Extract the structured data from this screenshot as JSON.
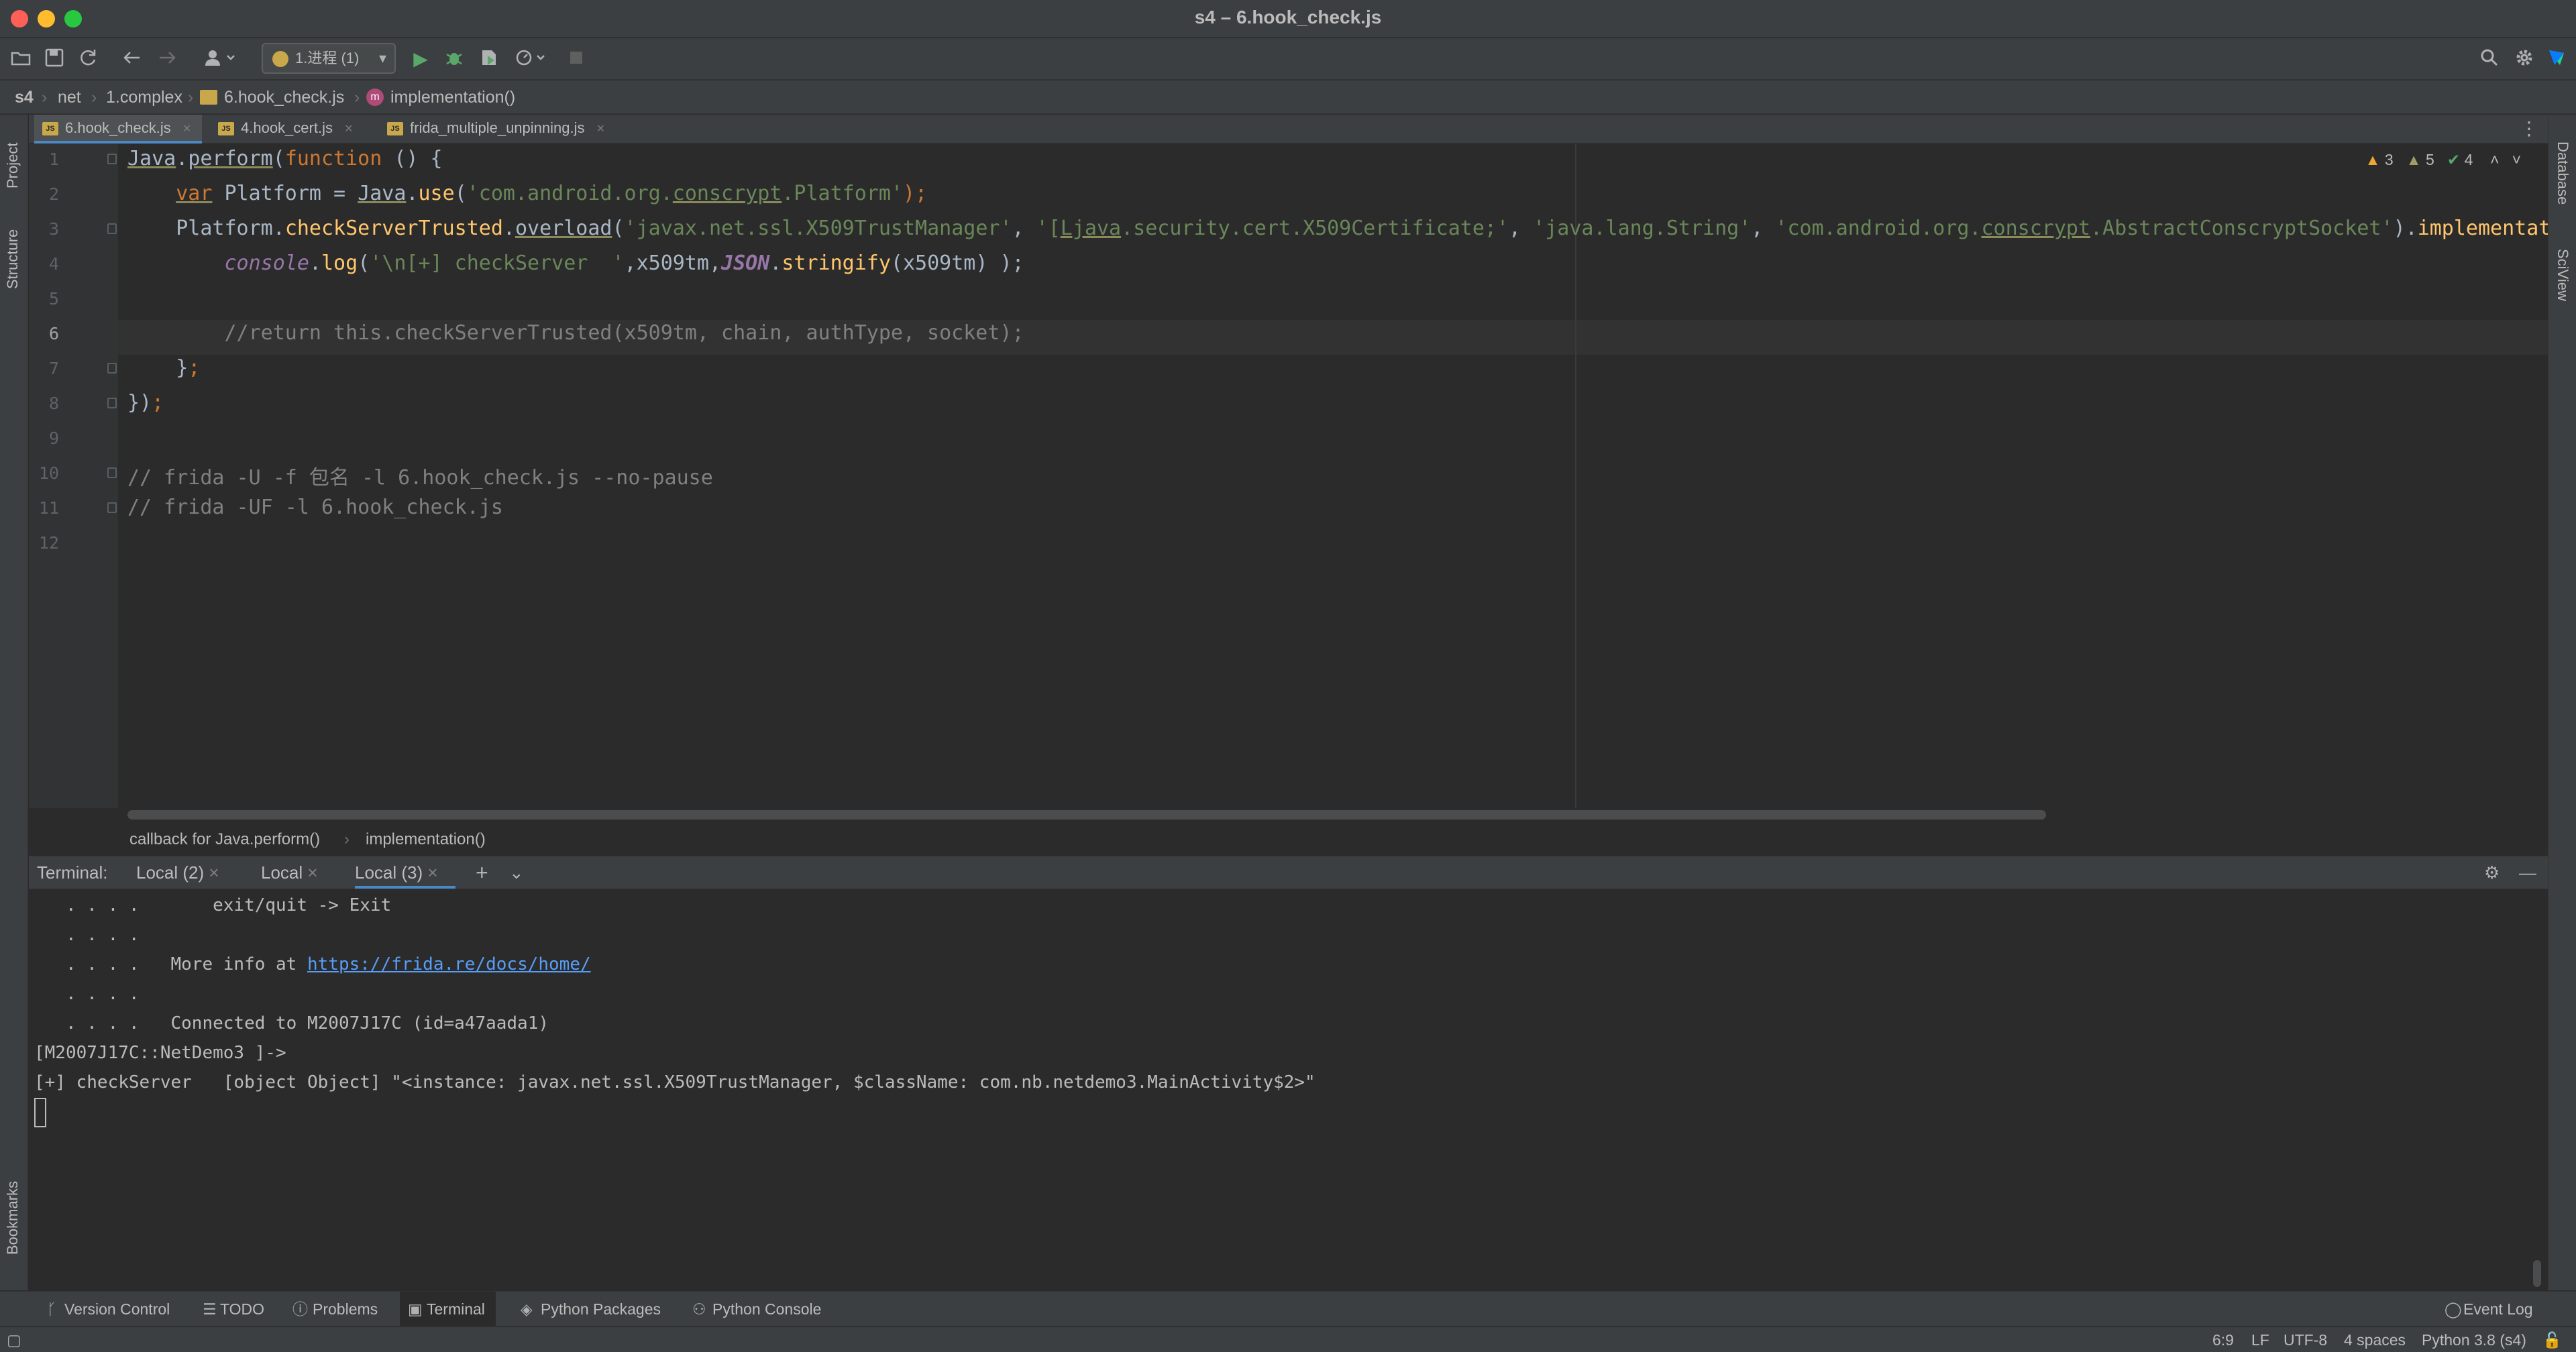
{
  "window": {
    "title": "s4 – 6.hook_check.js",
    "colors": {
      "close": "#fe5f57",
      "minimize": "#febc2e",
      "maximize": "#28c840"
    }
  },
  "toolbar": {
    "run_config": "1.进程 (1)",
    "icons": [
      "folder-open-icon",
      "save-icon",
      "sync-icon",
      "back-icon",
      "forward-icon",
      "user-icon",
      "run-icon",
      "debug-icon",
      "coverage-icon",
      "profile-icon",
      "stop-icon",
      "search-icon",
      "gear-icon",
      "jetbrains-icon"
    ]
  },
  "breadcrumb": [
    "s4",
    "net",
    "1.complex",
    "6.hook_check.js",
    "implementation()"
  ],
  "left_strip": {
    "project": "Project",
    "structure": "Structure",
    "bookmarks": "Bookmarks"
  },
  "right_strip": {
    "database": "Database",
    "sciview": "SciView"
  },
  "tabs": [
    {
      "label": "6.hook_check.js",
      "active": true
    },
    {
      "label": "4.hook_cert.js",
      "active": false
    },
    {
      "label": "frida_multiple_unpinning.js",
      "active": false
    }
  ],
  "inspections": {
    "warnings": "3",
    "weak": "5",
    "ok": "4"
  },
  "editor": {
    "current_line": 6,
    "lines": [
      "1",
      "2",
      "3",
      "4",
      "5",
      "6",
      "7",
      "8",
      "9",
      "10",
      "11",
      "12"
    ],
    "code": {
      "l1_a": "Java",
      "l1_b": ".",
      "l1_c": "perform",
      "l1_d": "(",
      "l1_e": "function",
      "l1_f": " () {",
      "l2_a": "    ",
      "l2_b": "var",
      "l2_c": " Platform = ",
      "l2_d": "Java",
      "l2_e": ".",
      "l2_f": "use",
      "l2_g": "(",
      "l2_h": "'com.android.org.",
      "l2_i": "conscrypt",
      "l2_j": ".Platform'",
      "l2_k": ");",
      "l3_a": "    Platform.",
      "l3_b": "checkServerTrusted",
      "l3_c": ".",
      "l3_d": "overload",
      "l3_e": "(",
      "l3_f": "'javax.net.ssl.X509TrustManager'",
      "l3_g": ", ",
      "l3_h": "'[",
      "l3_i": "Ljava",
      "l3_j": ".security.cert.X509Certificate;'",
      "l3_k": ", ",
      "l3_l": "'java.lang.String'",
      "l3_m": ", ",
      "l3_n": "'com.android.org.",
      "l3_o": "conscrypt",
      "l3_p": ".AbstractConscryptSocket'",
      "l3_q": ").",
      "l3_r": "implementati",
      "l4_a": "        ",
      "l4_b": "console",
      "l4_c": ".",
      "l4_d": "log",
      "l4_e": "(",
      "l4_f": "'\\n[+] checkServer  '",
      "l4_g": ",x509tm,",
      "l4_h": "JSON",
      "l4_i": ".",
      "l4_j": "stringify",
      "l4_k": "(x509tm) );",
      "l6": "        //return this.checkServerTrusted(x509tm, chain, authType, socket);",
      "l7_a": "    }",
      "l7_b": ";",
      "l8_a": "})",
      "l8_b": ";",
      "l10": "// frida -U -f 包名 -l 6.hook_check.js --no-pause",
      "l11": "// frida -UF -l 6.hook_check.js"
    }
  },
  "structure_crumb": [
    "callback for Java.perform()",
    "implementation()"
  ],
  "terminal": {
    "label": "Terminal:",
    "tabs": [
      {
        "label": "Local (2)",
        "active": false
      },
      {
        "label": "Local",
        "active": false
      },
      {
        "label": "Local (3)",
        "active": true
      }
    ],
    "lines": {
      "t1": "   . . . .       exit/quit -> Exit",
      "t2": "   . . . .",
      "t3_a": "   . . . .   More info at ",
      "t3_link": "https://frida.re/docs/home/",
      "t4": "   . . . .",
      "t5": "   . . . .   Connected to M2007J17C (id=a47aada1)",
      "t6": "[M2007J17C::NetDemo3 ]->",
      "t7": "[+] checkServer   [object Object] \"<instance: javax.net.ssl.X509TrustManager, $className: com.nb.netdemo3.MainActivity$2>\""
    }
  },
  "tool_windows": [
    {
      "label": "Version Control",
      "active": false
    },
    {
      "label": "TODO",
      "active": false
    },
    {
      "label": "Problems",
      "active": false
    },
    {
      "label": "Terminal",
      "active": true
    },
    {
      "label": "Python Packages",
      "active": false
    },
    {
      "label": "Python Console",
      "active": false
    }
  ],
  "event_log": "Event Log",
  "status": {
    "position": "6:9",
    "line_sep": "LF",
    "encoding": "UTF-8",
    "indent": "4 spaces",
    "interpreter": "Python 3.8 (s4)"
  }
}
